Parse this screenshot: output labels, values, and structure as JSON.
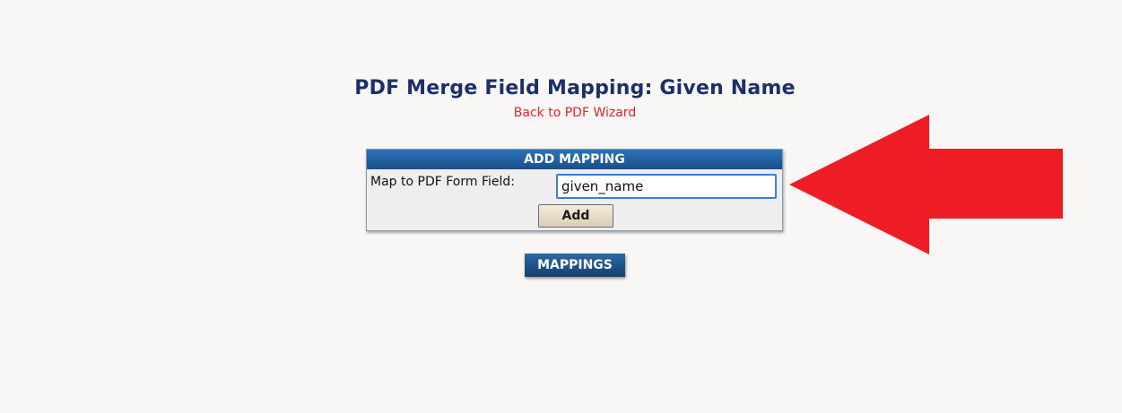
{
  "header": {
    "title": "PDF Merge Field Mapping: Given Name",
    "back_link": "Back to PDF Wizard"
  },
  "add_mapping": {
    "section_title": "ADD MAPPING",
    "field_label": "Map to PDF Form Field:",
    "field_value": "given_name",
    "add_button": "Add"
  },
  "mappings": {
    "label": "MAPPINGS"
  },
  "annotation": {
    "arrow_color": "#ee1c25",
    "icon": "arrow-left-icon"
  }
}
